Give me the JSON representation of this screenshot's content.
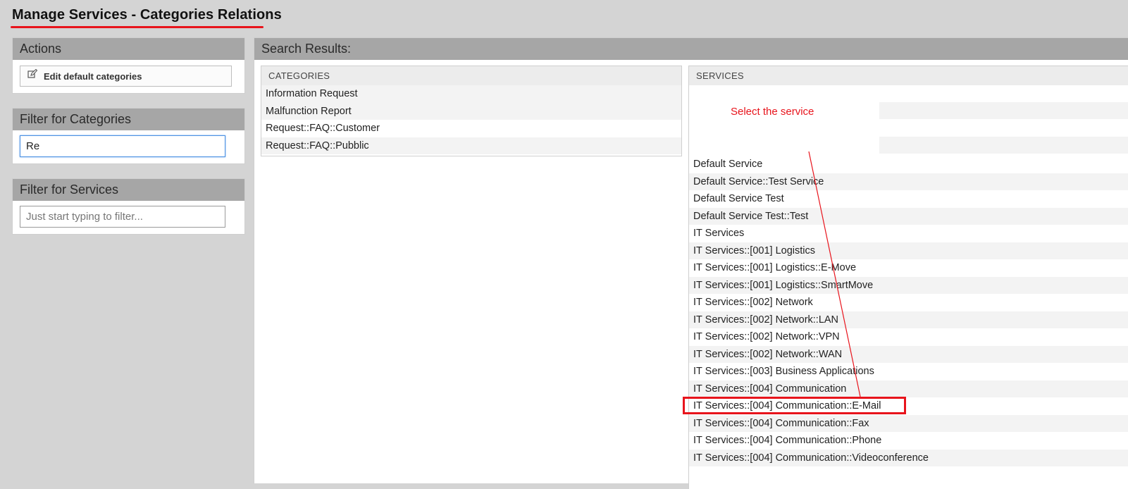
{
  "page": {
    "title": "Manage Services - Categories Relations"
  },
  "actions": {
    "header": "Actions",
    "edit_default_categories": "Edit default categories"
  },
  "filter_categories": {
    "header": "Filter for Categories",
    "value": "Re"
  },
  "filter_services": {
    "header": "Filter for Services",
    "value": "",
    "placeholder": "Just start typing to filter..."
  },
  "results": {
    "header": "Search Results:",
    "categories": {
      "column": "CATEGORIES",
      "rows": [
        "Information Request",
        "Malfunction Report",
        "Request::FAQ::Customer",
        "Request::FAQ::Pubblic"
      ]
    },
    "services": {
      "column": "SERVICES",
      "rows": [
        "Default Service",
        "Default Service::Test Service",
        "Default Service Test",
        "Default Service Test::Test",
        "IT Services",
        "IT Services::[001] Logistics",
        "IT Services::[001] Logistics::E-Move",
        "IT Services::[001] Logistics::SmartMove",
        "IT Services::[002] Network",
        "IT Services::[002] Network::LAN",
        "IT Services::[002] Network::VPN",
        "IT Services::[002] Network::WAN",
        "IT Services::[003] Business Applications",
        "IT Services::[004] Communication",
        "IT Services::[004] Communication::E-Mail",
        "IT Services::[004] Communication::Fax",
        "IT Services::[004] Communication::Phone",
        "IT Services::[004] Communication::Videoconference"
      ]
    }
  },
  "annotation": {
    "text": "Select the service",
    "color": "#e8141c"
  }
}
